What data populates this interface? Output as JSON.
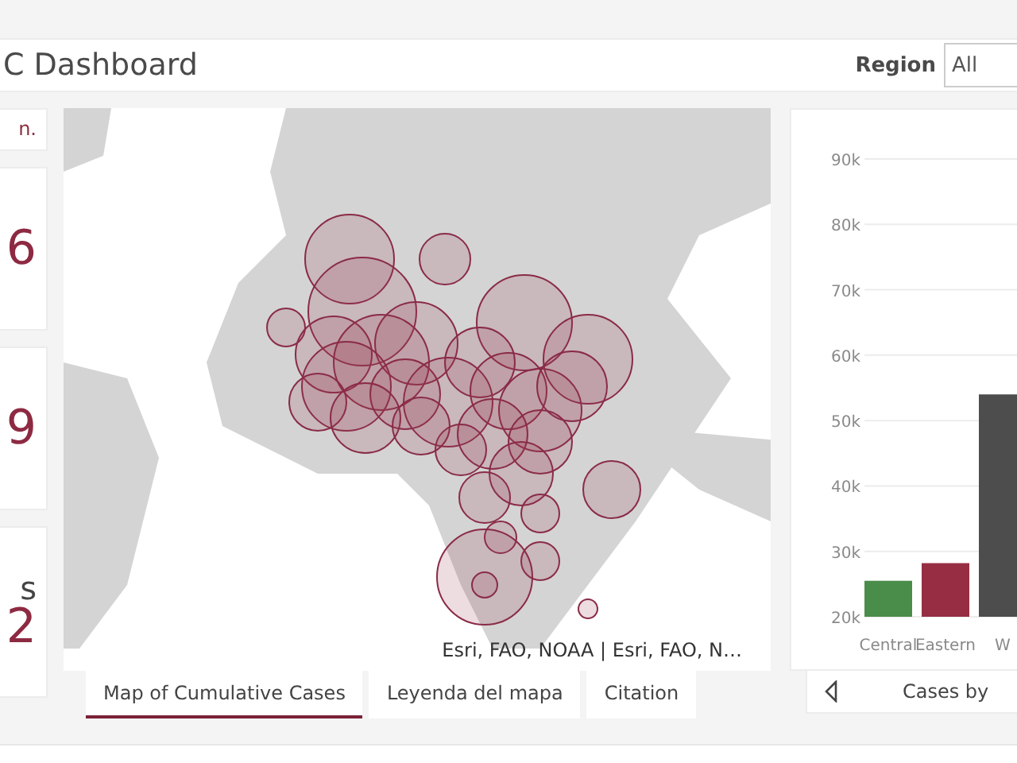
{
  "header": {
    "title": "C Dashboard",
    "filter": {
      "label": "Region",
      "value": "All"
    }
  },
  "cards": [
    {
      "kind": "note",
      "text": "n."
    },
    {
      "kind": "number",
      "value": "6"
    },
    {
      "kind": "number",
      "value": "9"
    },
    {
      "kind": "labeled",
      "label": "s",
      "value": "2"
    }
  ],
  "map": {
    "attribution": "Esri, FAO, NOAA | Esri, FAO, N…"
  },
  "map_tabs": [
    {
      "label": "Map of Cumulative Cases",
      "selected": true
    },
    {
      "label": "Leyenda del mapa",
      "selected": false
    },
    {
      "label": "Citation",
      "selected": false
    }
  ],
  "chart": {
    "chart_data": {
      "type": "bar",
      "categories": [
        "Central",
        "Eastern",
        "W"
      ],
      "series": [
        {
          "values": [
            25500,
            28200,
            54000
          ]
        }
      ],
      "grid": true,
      "colors": [
        "#4a8c4a",
        "#962d43",
        "#4d4d4d"
      ],
      "ylim": [
        20000,
        90000
      ],
      "yticks": [
        {
          "value": 20000,
          "label": "20k"
        },
        {
          "value": 30000,
          "label": "30k"
        },
        {
          "value": 40000,
          "label": "40k"
        },
        {
          "value": 50000,
          "label": "50k"
        },
        {
          "value": 60000,
          "label": "60k"
        },
        {
          "value": 70000,
          "label": "70k"
        },
        {
          "value": 80000,
          "label": "80k"
        },
        {
          "value": 90000,
          "label": "90k"
        }
      ]
    },
    "footer_title": "Cases by"
  }
}
